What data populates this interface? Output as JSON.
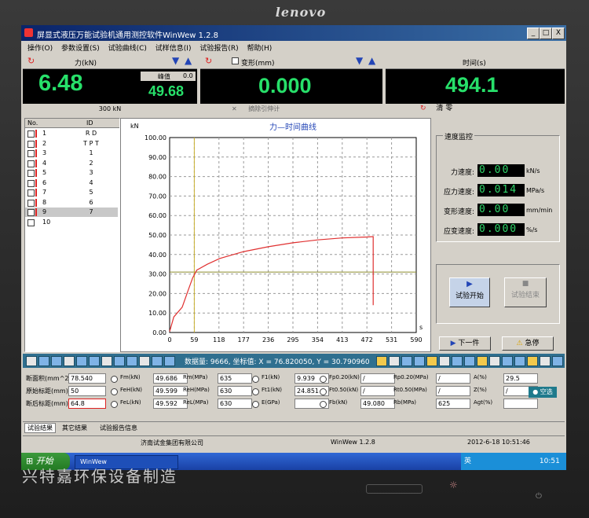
{
  "monitor": {
    "brand": "lenovo"
  },
  "window": {
    "title": "屏显式液压万能试验机通用测控软件WinWew 1.2.8",
    "min": "_",
    "max": "□",
    "close": "X"
  },
  "menu": [
    "操作(O)",
    "参数设置(S)",
    "试验曲线(C)",
    "试样信息(I)",
    "试验报告(R)",
    "帮助(H)"
  ],
  "force_panel": {
    "label": "力(kN)",
    "value": "6.48",
    "peak_label": "峰值",
    "peak_value": "0.0",
    "secondary": "49.68",
    "range": "300 kN"
  },
  "deform_panel": {
    "label": "变形(mm)",
    "value": "0.000",
    "remove_label": "摘除引伸计"
  },
  "time_panel": {
    "label": "时间(s)",
    "value": "494.1",
    "clear_label": "清 零"
  },
  "sample_list": {
    "headers": [
      "No.",
      "ID"
    ],
    "rows": [
      {
        "no": "1",
        "id": "R D"
      },
      {
        "no": "2",
        "id": "T P T"
      },
      {
        "no": "3",
        "id": "1"
      },
      {
        "no": "4",
        "id": "2"
      },
      {
        "no": "5",
        "id": "3"
      },
      {
        "no": "6",
        "id": "4"
      },
      {
        "no": "7",
        "id": "5"
      },
      {
        "no": "8",
        "id": "6"
      },
      {
        "no": "9",
        "id": "7"
      },
      {
        "no": "10",
        "id": ""
      }
    ]
  },
  "chart_data": {
    "type": "line",
    "title": "力—时间曲线",
    "ylabel": "kN",
    "xlabel": "s",
    "xlim": [
      0,
      590
    ],
    "ylim": [
      0,
      100
    ],
    "x_ticks": [
      "0",
      "59",
      "118",
      "177",
      "236",
      "295",
      "354",
      "413",
      "472",
      "531",
      "590"
    ],
    "y_ticks": [
      "0.00",
      "10.00",
      "20.00",
      "30.00",
      "40.00",
      "50.00",
      "60.00",
      "70.00",
      "80.00",
      "90.00",
      "100.00"
    ],
    "series": [
      {
        "values": [
          [
            0,
            0.5
          ],
          [
            10,
            8
          ],
          [
            30,
            13
          ],
          [
            45,
            22
          ],
          [
            55,
            28
          ],
          [
            65,
            32
          ],
          [
            90,
            35
          ],
          [
            120,
            38
          ],
          [
            177,
            41.5
          ],
          [
            236,
            44
          ],
          [
            295,
            46
          ],
          [
            354,
            47.5
          ],
          [
            413,
            48.5
          ],
          [
            472,
            49
          ],
          [
            487,
            49.2
          ],
          [
            487,
            14
          ]
        ]
      }
    ],
    "reference_lines": {
      "y": 31,
      "x": 59
    },
    "grid": true
  },
  "speed_panel": {
    "title": "速度监控",
    "rows": [
      {
        "label": "力速度:",
        "value": "0.00",
        "unit": "kN/s"
      },
      {
        "label": "应力速度:",
        "value": "0.014",
        "unit": "MPa/s"
      },
      {
        "label": "变形速度:",
        "value": "0.00",
        "unit": "mm/min"
      },
      {
        "label": "应变速度:",
        "value": "0.000",
        "unit": "%/s"
      }
    ]
  },
  "controls": {
    "start": "试验开始",
    "end": "试验结束",
    "next": "下一件",
    "estop": "急停"
  },
  "status_bar": {
    "text": "数据量: 9666, 坐标值: X = 76.820050, Y = 30.790960"
  },
  "results": {
    "area_label": "断面积(mm^2):",
    "area": "78.540",
    "l0_label": "原始标距(mm):",
    "l0": "50",
    "lu_label": "断后标距(mm):",
    "lu": "64.8",
    "col2": [
      {
        "label": "Fm(kN)",
        "value": "49.686"
      },
      {
        "label": "FeH(kN)",
        "value": "49.599"
      },
      {
        "label": "FeL(kN)",
        "value": "49.592"
      }
    ],
    "col3": [
      {
        "label": "Rm(MPa)",
        "value": "635"
      },
      {
        "label": "ReH(MPa)",
        "value": "630"
      },
      {
        "label": "ReL(MPa)",
        "value": "630"
      }
    ],
    "col4": [
      {
        "label": "F1(kN)",
        "value": "9.939"
      },
      {
        "label": "Ft1(kN)",
        "value": "24.851"
      },
      {
        "label": "E(GPa)",
        "value": ""
      }
    ],
    "col5": [
      {
        "label": "Fp0.20(kN)",
        "value": "/"
      },
      {
        "label": "Ft0.50(kN)",
        "value": "/"
      },
      {
        "label": "Fb(kN)",
        "value": "49.080"
      }
    ],
    "col6": [
      {
        "label": "Rp0.20(MPa)",
        "value": "/"
      },
      {
        "label": "Rt0.50(MPa)",
        "value": "/"
      },
      {
        "label": "Rb(MPa)",
        "value": "625"
      }
    ],
    "col7": [
      {
        "label": "A(%)",
        "value": "29.5"
      },
      {
        "label": "Z(%)",
        "value": "/"
      },
      {
        "label": "Agt(%)",
        "value": ""
      }
    ],
    "blank_button": "空选"
  },
  "tabs": [
    "试验结果",
    "其它结果",
    "试验报告信息"
  ],
  "status": {
    "company": "济南试金集团有限公司",
    "version": "WinWew 1.2.8",
    "datetime": "2012-6-18 10:51:46"
  },
  "taskbar": {
    "start": "开始",
    "app": "WinWew",
    "clock": "10:51",
    "lang": "英"
  },
  "watermark": "兴特嘉环保设备制造"
}
